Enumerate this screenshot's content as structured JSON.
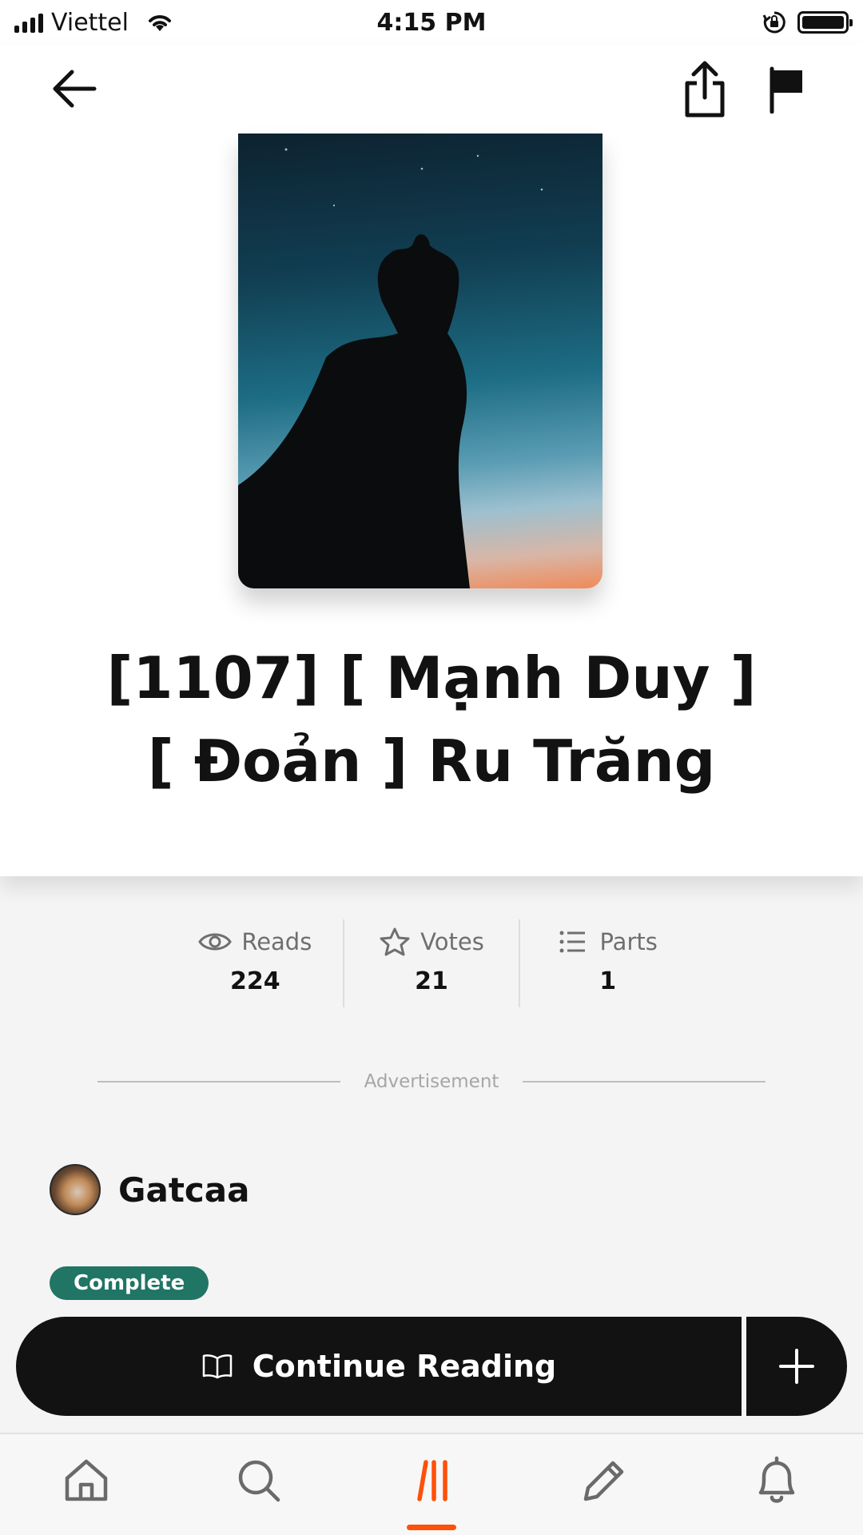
{
  "status_bar": {
    "carrier": "Viettel",
    "time": "4:15 PM"
  },
  "story": {
    "title_line1": "[1107] [ Mạnh Duy ]",
    "title_line2": "[ Đoản ] Ru Trăng"
  },
  "stats": [
    {
      "label": "Reads",
      "value": "224",
      "icon": "eye-icon"
    },
    {
      "label": "Votes",
      "value": "21",
      "icon": "star-icon"
    },
    {
      "label": "Parts",
      "value": "1",
      "icon": "list-icon"
    }
  ],
  "ad_label": "Advertisement",
  "author": {
    "name": "Gatcaa"
  },
  "status_badge": "Complete",
  "actions": {
    "continue_label": "Continue Reading"
  },
  "tabs": [
    {
      "name": "home",
      "icon": "home-icon",
      "active": false
    },
    {
      "name": "search",
      "icon": "search-icon",
      "active": false
    },
    {
      "name": "library",
      "icon": "library-icon",
      "active": true
    },
    {
      "name": "write",
      "icon": "pencil-icon",
      "active": false
    },
    {
      "name": "notifications",
      "icon": "bell-icon",
      "active": false
    }
  ],
  "colors": {
    "accent": "#ff500a",
    "badge": "#207565",
    "button": "#121212"
  }
}
